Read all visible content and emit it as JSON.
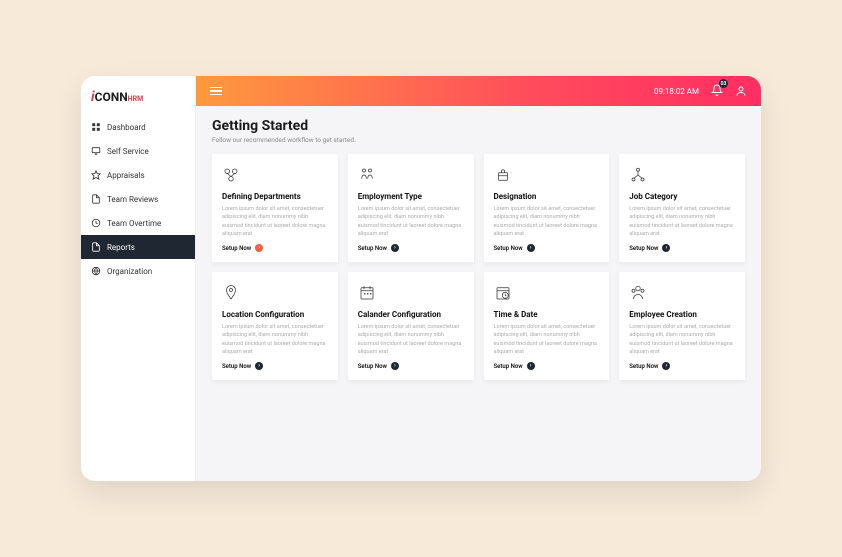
{
  "logo": {
    "i": "i",
    "conn": "CONN",
    "hrm": "HRM"
  },
  "sidebar": {
    "items": [
      {
        "label": "Dashboard"
      },
      {
        "label": "Self Service"
      },
      {
        "label": "Appraisals"
      },
      {
        "label": "Team Reviews"
      },
      {
        "label": "Team Overtime"
      },
      {
        "label": "Reports"
      },
      {
        "label": "Organization"
      }
    ]
  },
  "topbar": {
    "time": "09:18:02 AM",
    "notification_count": "03"
  },
  "page": {
    "title": "Getting Started",
    "subtitle": "Follow our recommended workflow to get started."
  },
  "cards": [
    {
      "title": "Defining Departments",
      "desc": "Lorem ipsum dolor sit amet, consectetuer adipiscing elit, diam nonummy nibh euismod tincidunt ut laoreet dolore magna aliquam erat",
      "action": "Setup Now",
      "accent": true
    },
    {
      "title": "Employment Type",
      "desc": "Lorem ipsum dolor sit amet, consectetuer adipiscing elit, diam nonummy nibh euismod tincidunt ut laoreet dolore magna aliquam erat",
      "action": "Setup Now",
      "accent": false
    },
    {
      "title": "Designation",
      "desc": "Lorem ipsum dolor sit amet, consectetuer adipiscing elit, diam nonummy nibh euismod tincidunt ut laoreet dolore magna aliquam erat",
      "action": "Setup Now",
      "accent": false
    },
    {
      "title": "Job Category",
      "desc": "Lorem ipsum dolor sit amet, consectetuer adipiscing elit, diam nonummy nibh euismod tincidunt ut laoreet dolore magna aliquam erat",
      "action": "Setup Now",
      "accent": false
    },
    {
      "title": "Location Configuration",
      "desc": "Lorem ipsum dolor sit amet, consectetuer adipiscing elit, diam nonummy nibh euismod tincidunt ut laoreet dolore magna aliquam erat",
      "action": "Setup Now",
      "accent": false
    },
    {
      "title": "Calander Configuration",
      "desc": "Lorem ipsum dolor sit amet, consectetuer adipiscing elit, diam nonummy nibh euismod tincidunt ut laoreet dolore magna aliquam erat",
      "action": "Setup Now",
      "accent": false
    },
    {
      "title": "Time & Date",
      "desc": "Lorem ipsum dolor sit amet, consectetuer adipiscing elit, diam nonummy nibh euismod tincidunt ut laoreet dolore magna aliquam erat",
      "action": "Setup Now",
      "accent": false
    },
    {
      "title": "Employee Creation",
      "desc": "Lorem ipsum dolor sit amet, consectetuer adipiscing elit, diam nonummy nibh euismod tincidunt ut laoreet dolore magna aliquam erat",
      "action": "Setup Now",
      "accent": false
    }
  ]
}
